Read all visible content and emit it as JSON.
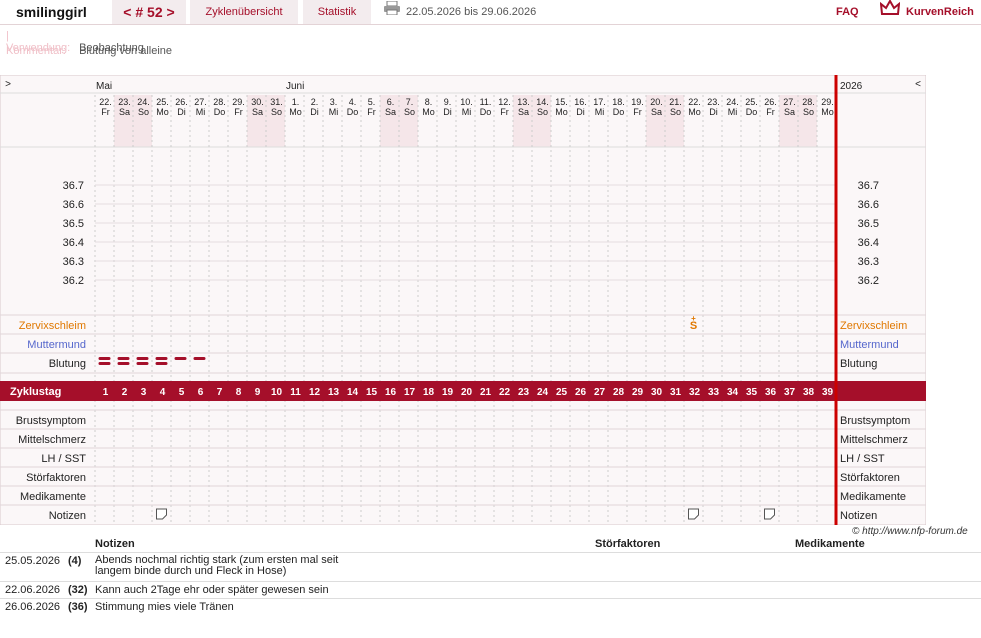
{
  "header": {
    "user": "smilinggirl",
    "cycle_nav": "< # 52 >",
    "tab_overview": "Zyklenübersicht",
    "tab_stats": "Statistik",
    "period": "22.05.2026 bis 29.06.2026",
    "faq": "FAQ",
    "brand": "KurvenReich"
  },
  "meta": {
    "usage_label": "| Verwendung:",
    "usage_value": "Beobachtung",
    "comment_label": "Kommentar:",
    "comment_value": "Blutung von alleine"
  },
  "chart": {
    "nav_left": ">",
    "nav_right": "<",
    "month_may": "Mai",
    "month_june": "Juni",
    "year": "2026",
    "days": [
      {
        "d": "22.",
        "w": "Fr",
        "we": false
      },
      {
        "d": "23.",
        "w": "Sa",
        "we": true
      },
      {
        "d": "24.",
        "w": "So",
        "we": true
      },
      {
        "d": "25.",
        "w": "Mo",
        "we": false
      },
      {
        "d": "26.",
        "w": "Di",
        "we": false
      },
      {
        "d": "27.",
        "w": "Mi",
        "we": false
      },
      {
        "d": "28.",
        "w": "Do",
        "we": false
      },
      {
        "d": "29.",
        "w": "Fr",
        "we": false
      },
      {
        "d": "30.",
        "w": "Sa",
        "we": true
      },
      {
        "d": "31.",
        "w": "So",
        "we": true
      },
      {
        "d": "1.",
        "w": "Mo",
        "we": false
      },
      {
        "d": "2.",
        "w": "Di",
        "we": false
      },
      {
        "d": "3.",
        "w": "Mi",
        "we": false
      },
      {
        "d": "4.",
        "w": "Do",
        "we": false
      },
      {
        "d": "5.",
        "w": "Fr",
        "we": false
      },
      {
        "d": "6.",
        "w": "Sa",
        "we": true
      },
      {
        "d": "7.",
        "w": "So",
        "we": true
      },
      {
        "d": "8.",
        "w": "Mo",
        "we": false
      },
      {
        "d": "9.",
        "w": "Di",
        "we": false
      },
      {
        "d": "10.",
        "w": "Mi",
        "we": false
      },
      {
        "d": "11.",
        "w": "Do",
        "we": false
      },
      {
        "d": "12.",
        "w": "Fr",
        "we": false
      },
      {
        "d": "13.",
        "w": "Sa",
        "we": true
      },
      {
        "d": "14.",
        "w": "So",
        "we": true
      },
      {
        "d": "15.",
        "w": "Mo",
        "we": false
      },
      {
        "d": "16.",
        "w": "Di",
        "we": false
      },
      {
        "d": "17.",
        "w": "Mi",
        "we": false
      },
      {
        "d": "18.",
        "w": "Do",
        "we": false
      },
      {
        "d": "19.",
        "w": "Fr",
        "we": false
      },
      {
        "d": "20.",
        "w": "Sa",
        "we": true
      },
      {
        "d": "21.",
        "w": "So",
        "we": true
      },
      {
        "d": "22.",
        "w": "Mo",
        "we": false
      },
      {
        "d": "23.",
        "w": "Di",
        "we": false
      },
      {
        "d": "24.",
        "w": "Mi",
        "we": false
      },
      {
        "d": "25.",
        "w": "Do",
        "we": false
      },
      {
        "d": "26.",
        "w": "Fr",
        "we": false
      },
      {
        "d": "27.",
        "w": "Sa",
        "we": true
      },
      {
        "d": "28.",
        "w": "So",
        "we": true
      },
      {
        "d": "29.",
        "w": "Mo",
        "we": false
      }
    ],
    "temps": [
      "36.7",
      "36.6",
      "36.5",
      "36.4",
      "36.3",
      "36.2"
    ],
    "rows": {
      "zervix": "Zervixschleim",
      "muttermund": "Muttermund",
      "blutung": "Blutung",
      "zyklustag": "Zyklustag",
      "brust": "Brustsymptom",
      "mittel": "Mittelschmerz",
      "lh": "LH / SST",
      "stoer": "Störfaktoren",
      "medi": "Medikamente",
      "notizen": "Notizen"
    },
    "bleeding": [
      2,
      2,
      2,
      2,
      1,
      1
    ],
    "zervix_marks": [
      {
        "day": 32,
        "symbol": "S+"
      }
    ],
    "note_days": [
      4,
      32,
      36
    ],
    "colors": {
      "accent": "#a50f2a",
      "zervix": "#e07800",
      "muttermund": "#5566cc",
      "grid": "#ccc",
      "weekend": "#f5e6e9"
    }
  },
  "copyright": "© http://www.nfp-forum.de",
  "notes": {
    "headers": {
      "notes": "Notizen",
      "stoer": "Störfaktoren",
      "medi": "Medikamente"
    },
    "entries": [
      {
        "date": "25.05.2026",
        "day": "(4)",
        "text": "Abends nochmal richtig stark (zum ersten mal seit langem binde durch und Fleck in Hose)"
      },
      {
        "date": "22.06.2026",
        "day": "(32)",
        "text": "Kann auch 2Tage ehr oder später gewesen sein"
      },
      {
        "date": "26.06.2026",
        "day": "(36)",
        "text": "Stimmung mies viele Tränen"
      }
    ]
  }
}
